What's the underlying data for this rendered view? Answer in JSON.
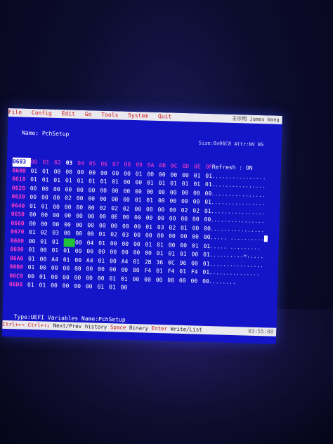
{
  "menu": {
    "file": {
      "hk": "F",
      "rest": "ile"
    },
    "config": {
      "hk": "C",
      "rest": "onfig"
    },
    "edit": {
      "hk": "E",
      "rest": "dit"
    },
    "go": {
      "hk": "G",
      "rest": "o"
    },
    "tools": {
      "hk": "T",
      "rest": "ools"
    },
    "system": {
      "hk": "S",
      "rest": "ystem"
    },
    "quit": {
      "hk": "Q",
      "rest": "uit"
    },
    "user": "王宗明 James Wang"
  },
  "header": {
    "name": "Name: PchSetup",
    "size_attr": "Size:0x06C8 Attr:NV BS"
  },
  "hex": {
    "header_addr": "0683",
    "columns": [
      "00",
      "01",
      "02",
      "03",
      "04",
      "05",
      "06",
      "07",
      "08",
      "09",
      "0A",
      "0B",
      "0C",
      "0D",
      "0E",
      "0F"
    ],
    "rows": [
      {
        "addr": "0600",
        "b": [
          "01",
          "01",
          "00",
          "00",
          "00",
          "00",
          "00",
          "00",
          "00",
          "01",
          "00",
          "00",
          "00",
          "00",
          "01",
          "01"
        ]
      },
      {
        "addr": "0610",
        "b": [
          "01",
          "01",
          "01",
          "01",
          "01",
          "01",
          "01",
          "01",
          "00",
          "00",
          "01",
          "01",
          "01",
          "01",
          "01",
          "01"
        ]
      },
      {
        "addr": "0620",
        "b": [
          "00",
          "00",
          "00",
          "00",
          "00",
          "00",
          "00",
          "00",
          "00",
          "00",
          "00",
          "00",
          "00",
          "00",
          "00",
          "00"
        ]
      },
      {
        "addr": "0630",
        "b": [
          "00",
          "00",
          "00",
          "02",
          "00",
          "00",
          "00",
          "00",
          "00",
          "01",
          "01",
          "00",
          "00",
          "00",
          "00",
          "01"
        ]
      },
      {
        "addr": "0640",
        "b": [
          "01",
          "01",
          "00",
          "00",
          "00",
          "00",
          "02",
          "02",
          "02",
          "00",
          "00",
          "00",
          "00",
          "02",
          "02",
          "01"
        ]
      },
      {
        "addr": "0650",
        "b": [
          "00",
          "00",
          "00",
          "00",
          "00",
          "00",
          "00",
          "0E",
          "00",
          "00",
          "00",
          "00",
          "00",
          "00",
          "00",
          "00"
        ]
      },
      {
        "addr": "0660",
        "b": [
          "00",
          "00",
          "00",
          "00",
          "00",
          "00",
          "00",
          "00",
          "00",
          "00",
          "01",
          "03",
          "02",
          "01",
          "00",
          "00"
        ]
      },
      {
        "addr": "0670",
        "b": [
          "01",
          "02",
          "03",
          "00",
          "00",
          "00",
          "01",
          "02",
          "03",
          "00",
          "00",
          "00",
          "00",
          "00",
          "00",
          "00"
        ]
      },
      {
        "addr": "0680",
        "b": [
          "00",
          "01",
          "01",
          "01",
          "00",
          "04",
          "01",
          "00",
          "00",
          "00",
          "01",
          "01",
          "00",
          "00",
          "01",
          "01"
        ]
      },
      {
        "addr": "0690",
        "b": [
          "01",
          "00",
          "01",
          "01",
          "00",
          "00",
          "00",
          "00",
          "00",
          "00",
          "00",
          "01",
          "01",
          "01",
          "00",
          "01"
        ]
      },
      {
        "addr": "06A0",
        "b": [
          "01",
          "00",
          "A4",
          "01",
          "00",
          "A4",
          "01",
          "00",
          "A4",
          "01",
          "2B",
          "36",
          "0C",
          "96",
          "00",
          "01"
        ]
      },
      {
        "addr": "06B0",
        "b": [
          "01",
          "00",
          "00",
          "00",
          "00",
          "00",
          "00",
          "00",
          "00",
          "00",
          "F4",
          "01",
          "F4",
          "01",
          "F4",
          "01"
        ]
      },
      {
        "addr": "06C0",
        "b": [
          "00",
          "01",
          "00",
          "00",
          "00",
          "00",
          "00",
          "01",
          "01",
          "00",
          "00",
          "00",
          "00",
          "00",
          "00",
          "00"
        ]
      },
      {
        "addr": "06D0",
        "b": [
          "01",
          "01",
          "00",
          "00",
          "00",
          "00",
          "01",
          "01",
          "00",
          "",
          "",
          "",
          "",
          "",
          "",
          ""
        ]
      }
    ],
    "ascii_refresh": "Refresh",
    "ascii_on": ": ON",
    "ascii_rows": [
      "................",
      "................",
      "................",
      "................",
      "................",
      "................",
      "................",
      "..... ..........",
      ".....  .........",
      "..........=.....",
      "................",
      "...............",
      "........",
      ""
    ]
  },
  "footer": {
    "type_line": "Type:UEFI Variables  Name:PchSetup",
    "k1": "Ctrl+←→",
    "k2": "Ctrl+↑↓",
    "nav": "Next/Prev history",
    "k3": "Space",
    "binary": "Binary",
    "k4": "Enter",
    "write": "Write/List",
    "time": "03:55:08"
  }
}
